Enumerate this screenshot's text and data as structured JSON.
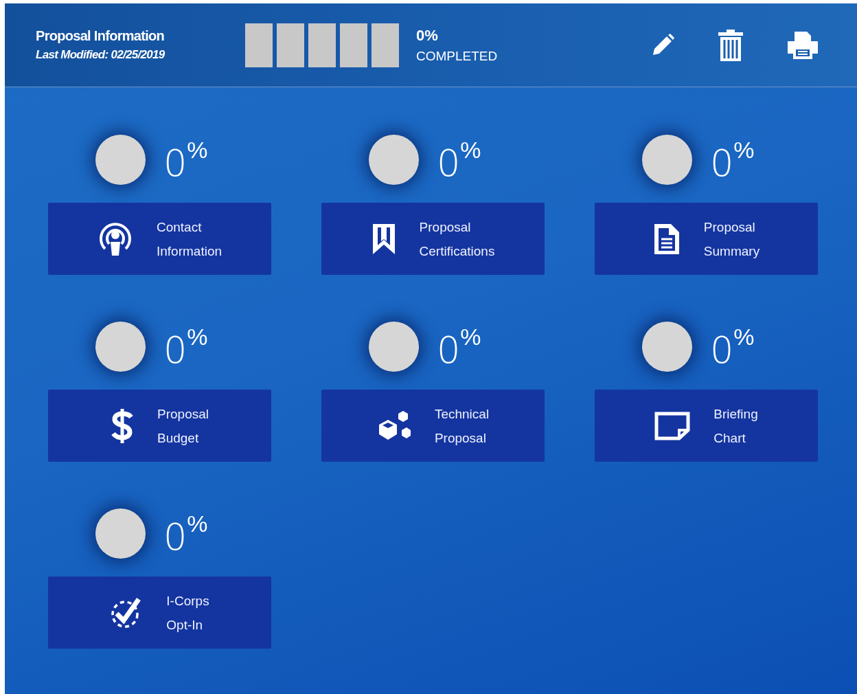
{
  "header": {
    "title": "Proposal Information",
    "modified": "Last Modified: 02/25/2019",
    "progress": {
      "steps": [
        {
          "done": false
        },
        {
          "done": false
        },
        {
          "done": false
        },
        {
          "done": false
        },
        {
          "done": false
        }
      ],
      "percent": "0%",
      "label": "COMPLETED"
    }
  },
  "sections": [
    {
      "kind": "contact",
      "title": "Contact",
      "subtitle": "Information",
      "value": "0",
      "unit": "%"
    },
    {
      "kind": "bookmark",
      "title": "Proposal",
      "subtitle": "Certifications",
      "value": "0",
      "unit": "%"
    },
    {
      "kind": "document",
      "title": "Proposal",
      "subtitle": "Summary",
      "value": "0",
      "unit": "%"
    },
    {
      "kind": "budget",
      "title": "Proposal",
      "subtitle": "Budget",
      "value": "0",
      "unit": "%"
    },
    {
      "kind": "cubes",
      "title": "Technical",
      "subtitle": "Proposal",
      "value": "0",
      "unit": "%"
    },
    {
      "kind": "note",
      "title": "Briefing",
      "subtitle": "Chart",
      "value": "0",
      "unit": "%"
    },
    {
      "kind": "check",
      "title": "I-Corps",
      "subtitle": "Opt-In",
      "value": "0",
      "unit": "%"
    }
  ]
}
